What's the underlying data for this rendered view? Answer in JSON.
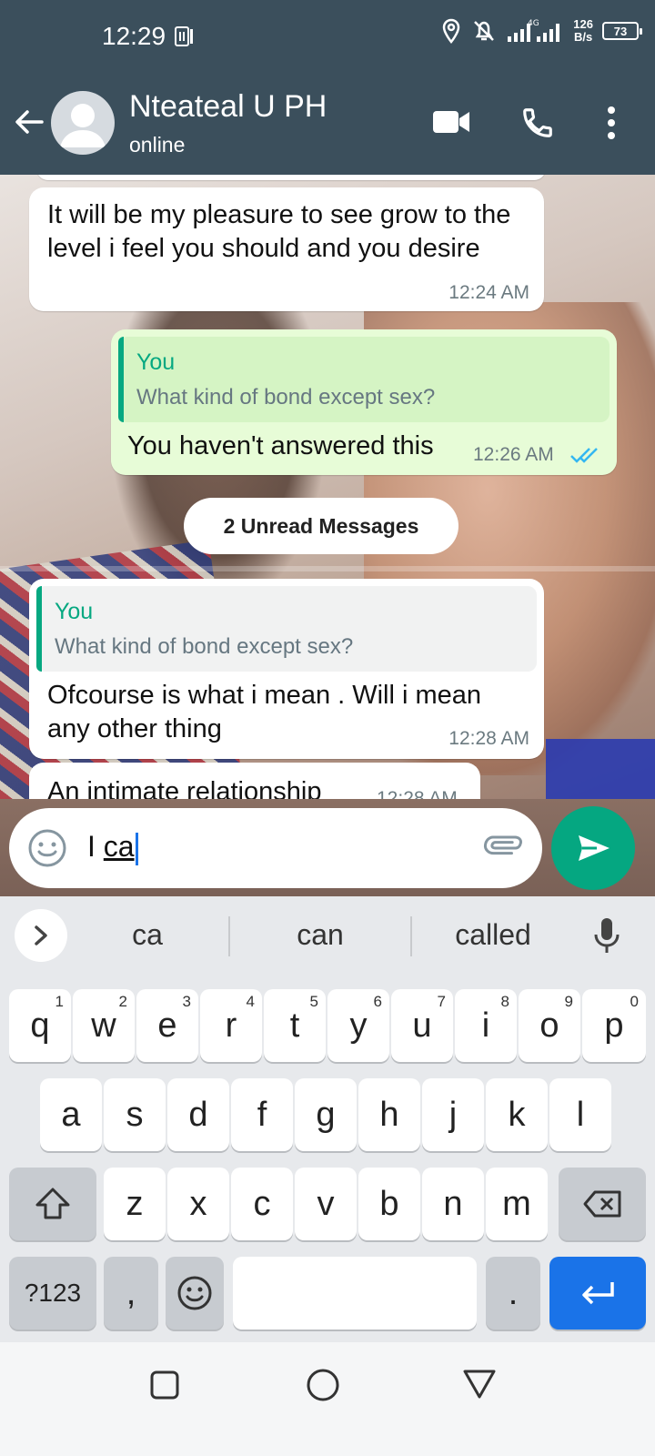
{
  "status_bar": {
    "time": "12:29",
    "net_speed_value": "126",
    "net_speed_unit": "B/s",
    "battery": "73"
  },
  "header": {
    "contact_name": "Nteateal U PH",
    "status": "online"
  },
  "messages": [
    {
      "direction": "in",
      "text": "It will be my pleasure to see grow to the level i feel you should and you desire",
      "time": "12:24 AM"
    },
    {
      "direction": "out",
      "quote_author": "You",
      "quote_text": "What kind of bond except sex?",
      "text": "You haven't answered this",
      "time": "12:26 AM",
      "read": true
    },
    {
      "direction": "in",
      "quote_author": "You",
      "quote_text": "What kind of bond except sex?",
      "text": "Ofcourse is what i mean . Will i mean any other thing",
      "time": "12:28 AM"
    },
    {
      "direction": "in",
      "text": "An intimate relationship",
      "time": "12:28 AM"
    }
  ],
  "unread_label": "2 Unread Messages",
  "composer": {
    "prefix": "I ",
    "composing": "ca"
  },
  "keyboard": {
    "suggestions": [
      "ca",
      "can",
      "called"
    ],
    "row1": [
      "q",
      "w",
      "e",
      "r",
      "t",
      "y",
      "u",
      "i",
      "o",
      "p"
    ],
    "row1_hints": [
      "1",
      "2",
      "3",
      "4",
      "5",
      "6",
      "7",
      "8",
      "9",
      "0"
    ],
    "row2": [
      "a",
      "s",
      "d",
      "f",
      "g",
      "h",
      "j",
      "k",
      "l"
    ],
    "row3": [
      "z",
      "x",
      "c",
      "v",
      "b",
      "n",
      "m"
    ],
    "symbols_key": "?123",
    "comma_key": ",",
    "period_key": "."
  },
  "colors": {
    "header_bg": "#3b4f5c",
    "accent": "#06a881",
    "outgoing_bubble": "#e7fcd7",
    "enter_key": "#1a73e8"
  }
}
